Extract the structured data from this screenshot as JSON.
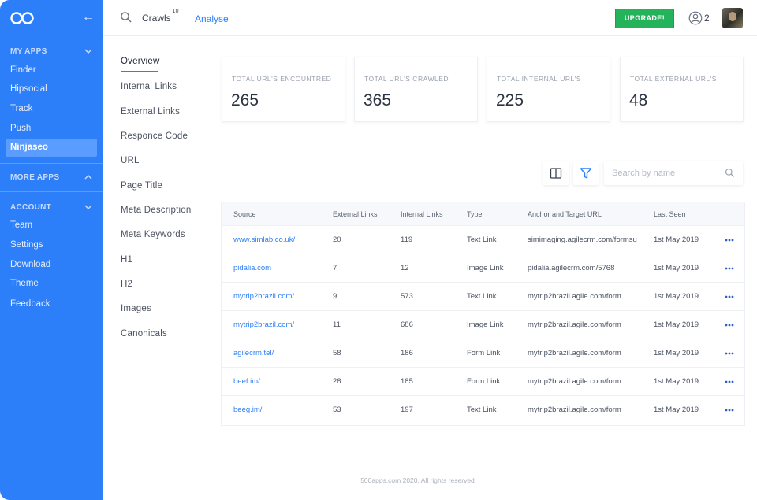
{
  "sidebar": {
    "sections": {
      "my_apps": "MY APPS",
      "more_apps": "MORE APPS",
      "account": "ACCOUNT"
    },
    "my_apps_items": [
      "Finder",
      "Hipsocial",
      "Track",
      "Push",
      "Ninjaseo"
    ],
    "account_items": [
      "Team",
      "Settings",
      "Download",
      "Theme",
      "Feedback"
    ],
    "active_item": "Ninjaseo"
  },
  "topbar": {
    "tab_crawls": "Crawls",
    "crawls_count": "10",
    "tab_analyse": "Analyse",
    "upgrade_label": "UPGRADE!",
    "user_count": "2"
  },
  "subnav": {
    "items": [
      "Overview",
      "Internal Links",
      "External Links",
      "Responce Code",
      "URL",
      "Page Title",
      "Meta Description",
      "Meta Keywords",
      "H1",
      "H2",
      "Images",
      "Canonicals"
    ],
    "active": "Overview"
  },
  "stats": [
    {
      "label": "TOTAL URL'S ENCOUNTRED",
      "value": "265"
    },
    {
      "label": "TOTAL URL'S CRAWLED",
      "value": "365"
    },
    {
      "label": "TOTAL INTERNAL URL'S",
      "value": "225"
    },
    {
      "label": "TOTAL EXTERNAL URL'S",
      "value": "48"
    }
  ],
  "search": {
    "placeholder": "Search by name",
    "value": ""
  },
  "table": {
    "columns": [
      "Source",
      "External Links",
      "Internal Links",
      "Type",
      "Anchor and Target URL",
      "Last Seen"
    ],
    "rows": [
      {
        "source": "www.simlab.co.uk/",
        "external": "20",
        "internal": "119",
        "type": "Text Link",
        "anchor": "simimaging.agilecrm.com/formsu",
        "last_seen": "1st May 2019"
      },
      {
        "source": "pidalia.com",
        "external": "7",
        "internal": "12",
        "type": "Image Link",
        "anchor": "pidalia.agilecrm.com/5768",
        "last_seen": "1st May 2019"
      },
      {
        "source": "mytrip2brazil.com/",
        "external": "9",
        "internal": "573",
        "type": "Text Link",
        "anchor": "mytrip2brazil.agile.com/form",
        "last_seen": "1st May 2019"
      },
      {
        "source": "mytrip2brazil.com/",
        "external": "11",
        "internal": "686",
        "type": "Image Link",
        "anchor": "mytrip2brazil.agile.com/form",
        "last_seen": "1st May 2019"
      },
      {
        "source": "agilecrm.tel/",
        "external": "58",
        "internal": "186",
        "type": "Form Link",
        "anchor": "mytrip2brazil.agile.com/form",
        "last_seen": "1st May 2019"
      },
      {
        "source": "beef.im/",
        "external": "28",
        "internal": "185",
        "type": "Form Link",
        "anchor": "mytrip2brazil.agile.com/form",
        "last_seen": "1st May 2019"
      },
      {
        "source": "beeg.im/",
        "external": "53",
        "internal": "197",
        "type": "Text Link",
        "anchor": "mytrip2brazil.agile.com/form",
        "last_seen": "1st May 2019"
      }
    ]
  },
  "footer": "500apps.com 2020. All rights reserved",
  "colors": {
    "brand": "#2d7ff9",
    "upgrade": "#24b35a",
    "link": "#2d7ff9"
  },
  "icons": {
    "logo": "infinity-logo-icon",
    "collapse": "arrow-left-icon",
    "search": "search-icon",
    "user": "user-circle-icon",
    "columns": "columns-icon",
    "filter": "filter-icon",
    "more": "more-dots-icon"
  }
}
